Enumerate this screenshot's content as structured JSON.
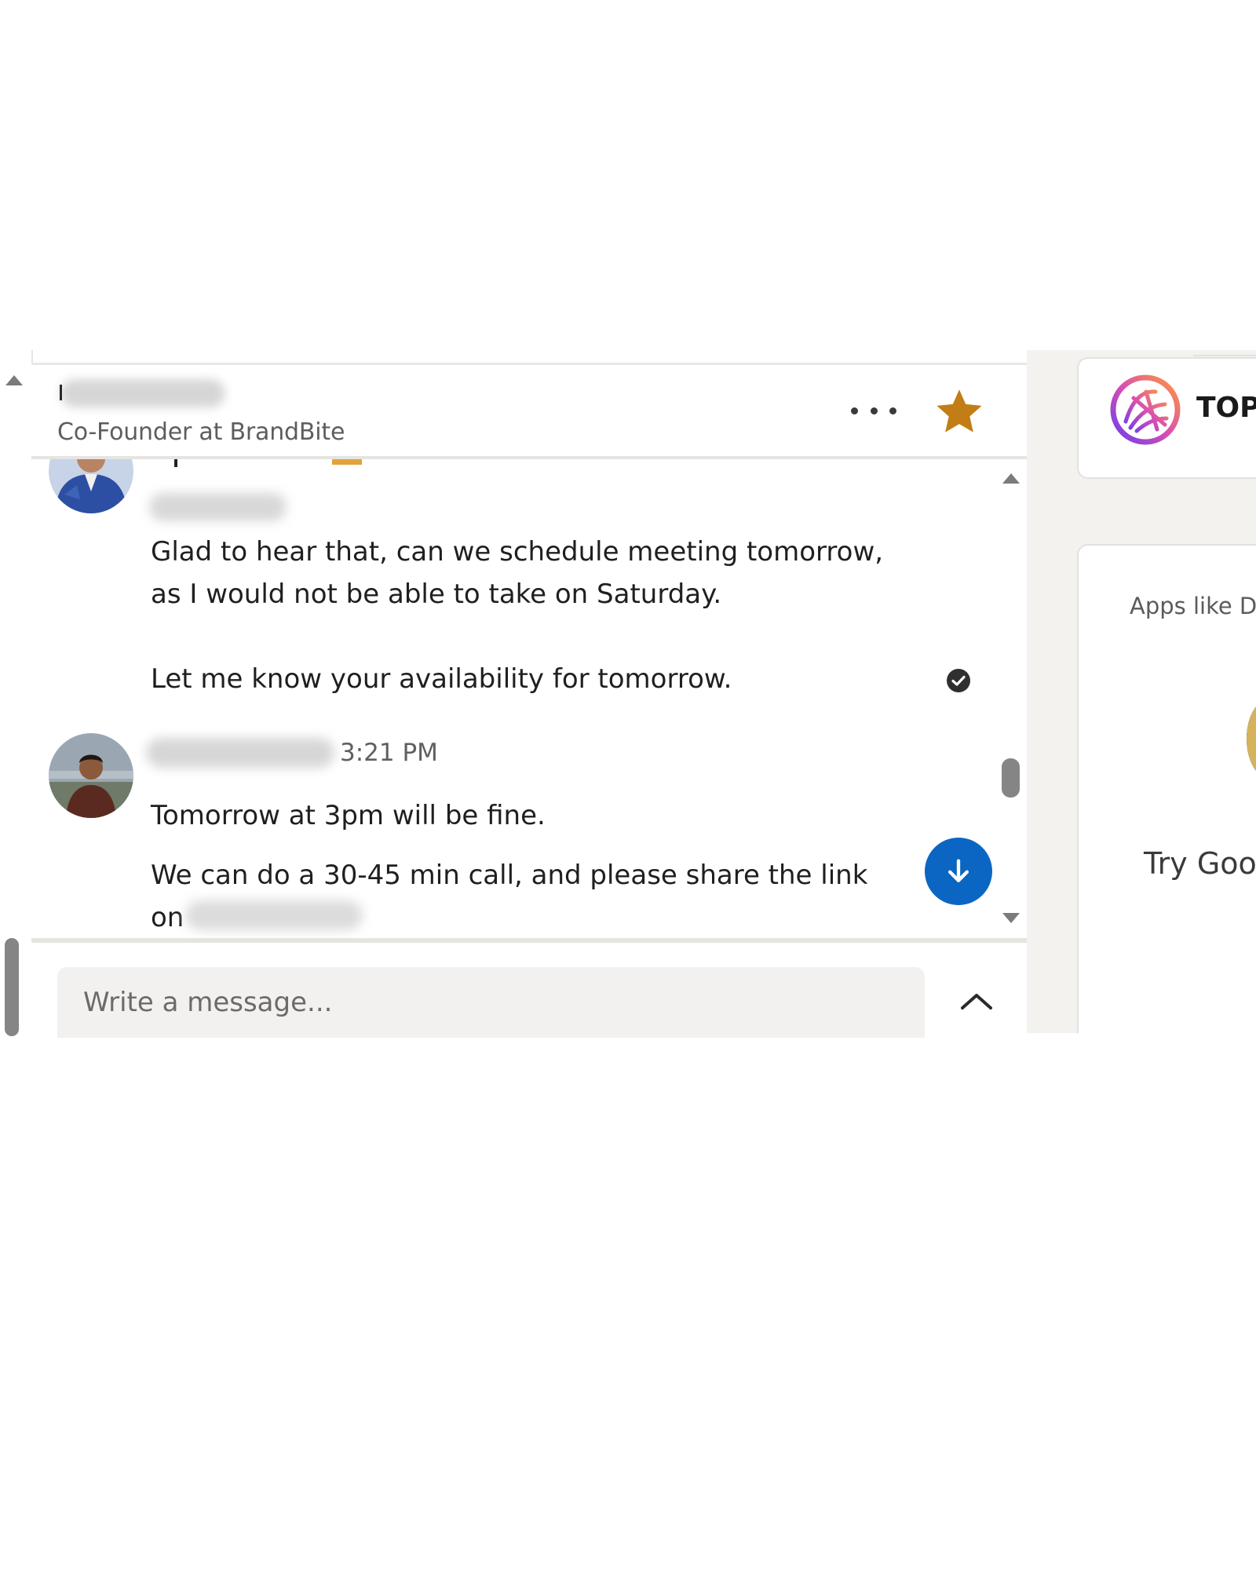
{
  "conversation": {
    "headline": "Co-Founder at BrandBite",
    "more_icon": "more-horizontal-icon",
    "star_icon": "star-filled-icon",
    "star_color": "#c37d16"
  },
  "messages": [
    {
      "lines": [
        "Glad to hear that, can we schedule meeting tomorrow,",
        "as I would not be able to take on Saturday.",
        "Let me know your availability for tomorrow."
      ],
      "status_icon": "read-check-icon"
    },
    {
      "time": "3:21 PM",
      "lines": [
        "Tomorrow at 3pm will be fine.",
        "We can do a 30-45 min call, and please share the link",
        "on"
      ]
    }
  ],
  "jump_to_latest_icon": "arrow-down-icon",
  "accent_color": "#0a66c2",
  "composer": {
    "placeholder": "Write a message...",
    "expand_icon": "chevron-up-icon"
  },
  "right_rail": {
    "promo_title": "TOPI",
    "apps_like": "Apps like D",
    "try_text": "Try Goog"
  }
}
